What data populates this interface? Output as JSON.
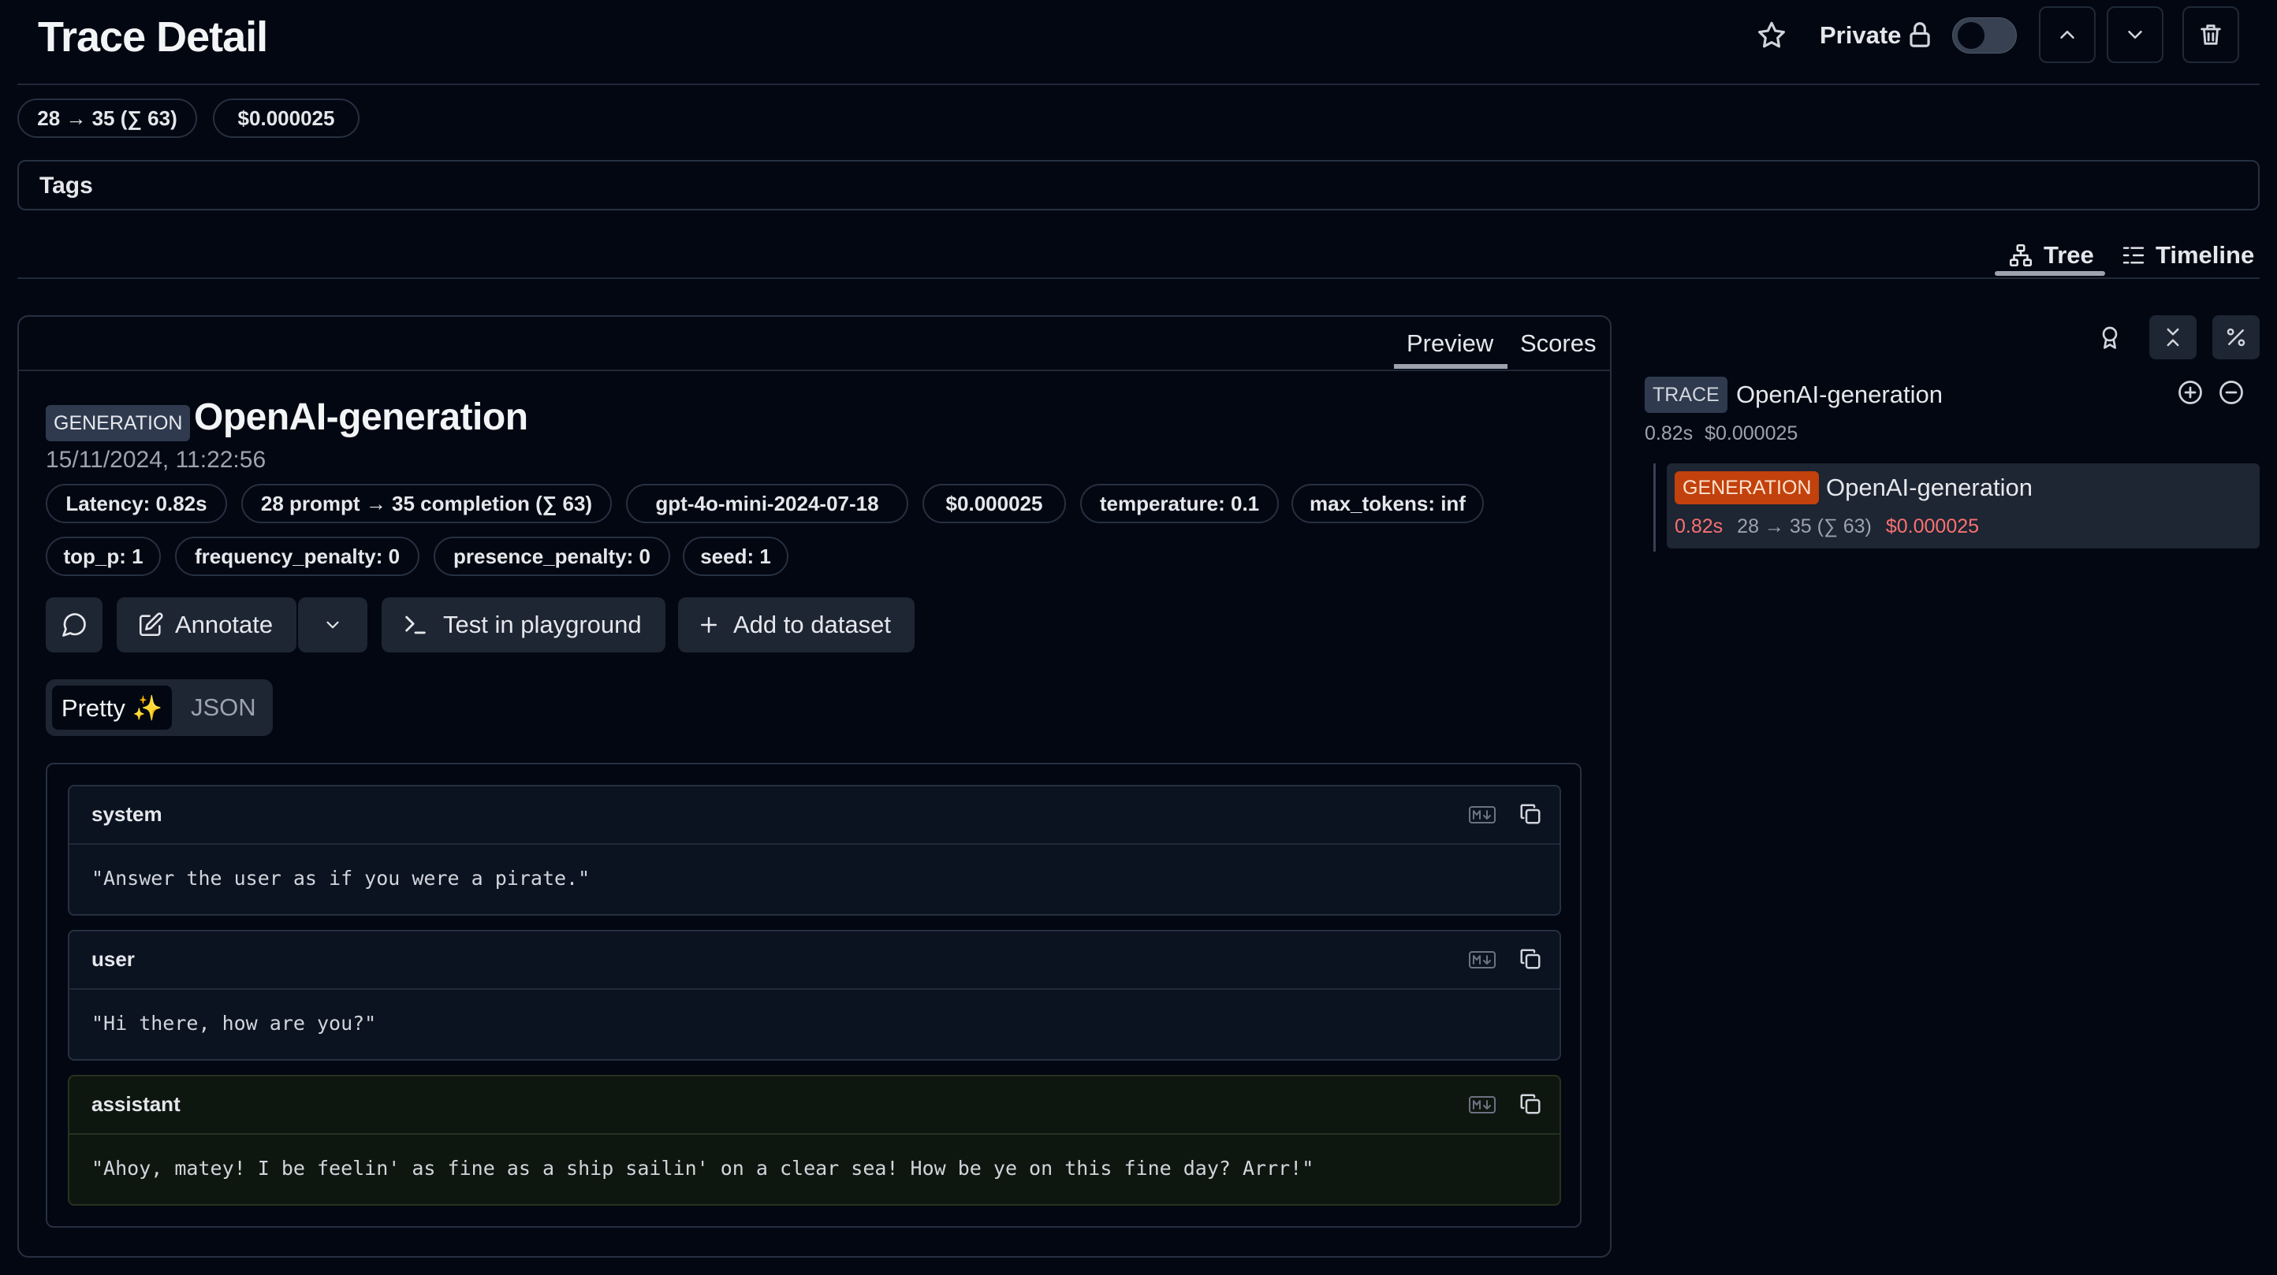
{
  "header": {
    "title": "Trace Detail",
    "private_label": "Private",
    "toggle_state": "off"
  },
  "summary": {
    "tokens": "28 → 35 (∑ 63)",
    "cost": "$0.000025"
  },
  "tags": {
    "label": "Tags"
  },
  "view_tabs": {
    "tree": "Tree",
    "timeline": "Timeline",
    "active": "Tree"
  },
  "panel": {
    "tabs": {
      "preview": "Preview",
      "scores": "Scores",
      "active": "Preview"
    },
    "type_badge": "GENERATION",
    "name": "OpenAI-generation",
    "timestamp": "15/11/2024, 11:22:56",
    "metrics": [
      "Latency: 0.82s",
      "28 prompt → 35 completion (∑ 63)",
      "gpt-4o-mini-2024-07-18",
      "$0.000025",
      "temperature: 0.1",
      "max_tokens: inf",
      "top_p: 1",
      "frequency_penalty: 0",
      "presence_penalty: 0",
      "seed: 1"
    ],
    "actions": {
      "annotate": "Annotate",
      "playground": "Test in playground",
      "dataset": "Add to dataset"
    },
    "format": {
      "pretty": "Pretty ✨",
      "json": "JSON",
      "active": "Pretty"
    },
    "messages": [
      {
        "role": "system",
        "content": "\"Answer the user as if you were a pirate.\""
      },
      {
        "role": "user",
        "content": "\"Hi there, how are you?\""
      },
      {
        "role": "assistant",
        "content": "\"Ahoy, matey! I be feelin' as fine as a ship sailin' on a clear sea! How be ye on this fine day? Arrr!\""
      }
    ]
  },
  "tree": {
    "trace": {
      "badge": "TRACE",
      "name": "OpenAI-generation",
      "latency": "0.82s",
      "cost": "$0.000025"
    },
    "generation": {
      "badge": "GENERATION",
      "name": "OpenAI-generation",
      "latency": "0.82s",
      "tokens": "28 → 35 (∑ 63)",
      "cost": "$0.000025"
    }
  },
  "colors": {
    "background": "#030712",
    "border": "#263040",
    "generation_badge": "#c2410c",
    "cost_highlight": "#f87171"
  }
}
